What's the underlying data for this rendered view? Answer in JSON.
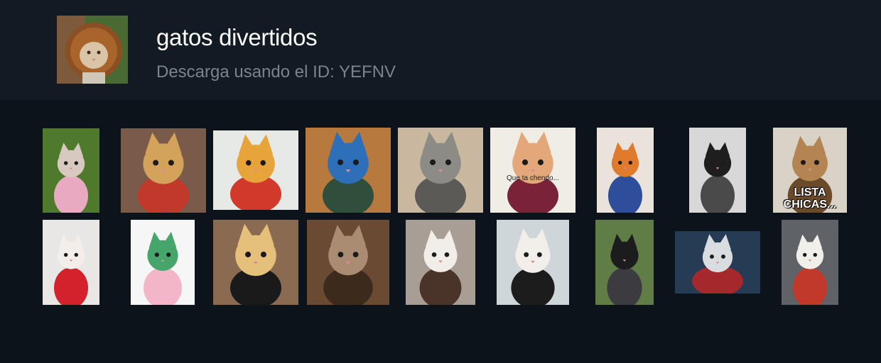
{
  "channel": {
    "title": "gatos divertidos",
    "subtitle": "Descarga usando el ID: YEFNV",
    "avatar_icon": "lion-mane-cat-image"
  },
  "stickers": [
    {
      "name": "sticker-bunny-ears-bulldog",
      "bg": "#4f7a2c",
      "fg": "#d7c9c0",
      "accent": "#e8a9c1",
      "caption": ""
    },
    {
      "name": "sticker-harley-dog",
      "bg": "#7a5b49",
      "fg": "#d4a35b",
      "accent": "#c0392b",
      "caption": ""
    },
    {
      "name": "sticker-pikachu-cat",
      "bg": "#e7e9e6",
      "fg": "#e7a43a",
      "accent": "#d13a2a",
      "caption": ""
    },
    {
      "name": "sticker-peacock-cat",
      "bg": "#b8793e",
      "fg": "#2d6fb8",
      "accent": "#2f4e3b",
      "caption": ""
    },
    {
      "name": "sticker-shark-hat-cat",
      "bg": "#c9b79f",
      "fg": "#8d8b86",
      "accent": "#5c5a56",
      "caption": ""
    },
    {
      "name": "sticker-hat-kitten",
      "bg": "#efede4",
      "fg": "#e3a77a",
      "accent": "#7a2336",
      "caption": "Que ta chendo..."
    },
    {
      "name": "sticker-goku-cat",
      "bg": "#e9e3db",
      "fg": "#e07a2c",
      "accent": "#2e4d9a",
      "caption": ""
    },
    {
      "name": "sticker-bandana-cat",
      "bg": "#d8d8d8",
      "fg": "#1e1e1e",
      "accent": "#4a4a4a",
      "caption": ""
    },
    {
      "name": "sticker-wig-cat",
      "bg": "#d9d2c6",
      "fg": "#b48553",
      "accent": "#6b4a2a",
      "caption": "LISTA CHICAS..."
    },
    {
      "name": "sticker-banlieue-cat",
      "bg": "#e9e6e6",
      "fg": "#f3eeea",
      "accent": "#d3222b",
      "caption": ""
    },
    {
      "name": "sticker-frog-hood-cat",
      "bg": "#f6f6f6",
      "fg": "#45a56b",
      "accent": "#f3b6c9",
      "caption": ""
    },
    {
      "name": "sticker-sunglasses-cat",
      "bg": "#8a6b52",
      "fg": "#e5c07a",
      "accent": "#1a1a1a",
      "caption": ""
    },
    {
      "name": "sticker-peeking-cat",
      "bg": "#6b4a33",
      "fg": "#a98c72",
      "accent": "#3c2a1d",
      "caption": ""
    },
    {
      "name": "sticker-pigtails-cat",
      "bg": "#a89e96",
      "fg": "#f1ede9",
      "accent": "#4a3328",
      "caption": ""
    },
    {
      "name": "sticker-two-cats-window",
      "bg": "#cfd6d9",
      "fg": "#f2efea",
      "accent": "#1c1c1c",
      "caption": ""
    },
    {
      "name": "sticker-darth-vader-cat",
      "bg": "#5f7d44",
      "fg": "#1c1c1e",
      "accent": "#3c3c40",
      "caption": ""
    },
    {
      "name": "sticker-joker-cat",
      "bg": "#263c55",
      "fg": "#d9dde0",
      "accent": "#a5282c",
      "caption": ""
    },
    {
      "name": "sticker-creepy-white-cat",
      "bg": "#5f6266",
      "fg": "#f1efea",
      "accent": "#c0392b",
      "caption": ""
    }
  ]
}
